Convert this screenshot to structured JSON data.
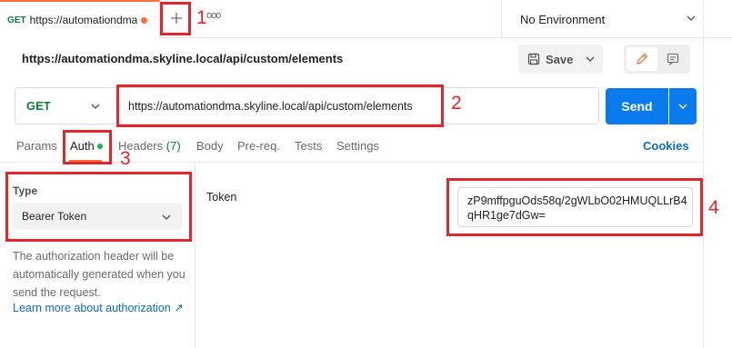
{
  "tab": {
    "method": "GET",
    "title": "https://automationdma",
    "more": "ooo"
  },
  "environment": {
    "label": "No Environment"
  },
  "request": {
    "title": "https://automationdma.skyline.local/api/custom/elements",
    "method": "GET",
    "url": "https://automationdma.skyline.local/api/custom/elements"
  },
  "toolbar": {
    "save_label": "Save",
    "send_label": "Send"
  },
  "request_tabs": {
    "params": "Params",
    "auth": "Auth",
    "headers": "Headers",
    "headers_count": "(7)",
    "body": "Body",
    "prereq": "Pre-req.",
    "tests": "Tests",
    "settings": "Settings",
    "cookies": "Cookies"
  },
  "auth": {
    "type_label": "Type",
    "type_value": "Bearer Token",
    "description": "The authorization header will be automatically generated when you send the request.",
    "learn_more": "Learn more about authorization ↗",
    "token_label": "Token",
    "token_value": "zP9mffpguOds58q/2gWLbO02HMUQLLrB4qHR1ge7dGw="
  },
  "annotations": {
    "n1": "1",
    "n2": "2",
    "n3": "3",
    "n4": "4"
  },
  "colors": {
    "accent": "#ff6c37",
    "send": "#097bed",
    "method_get": "#0f7b3a",
    "link": "#0b6bcb",
    "annotation": "#e3262b"
  }
}
